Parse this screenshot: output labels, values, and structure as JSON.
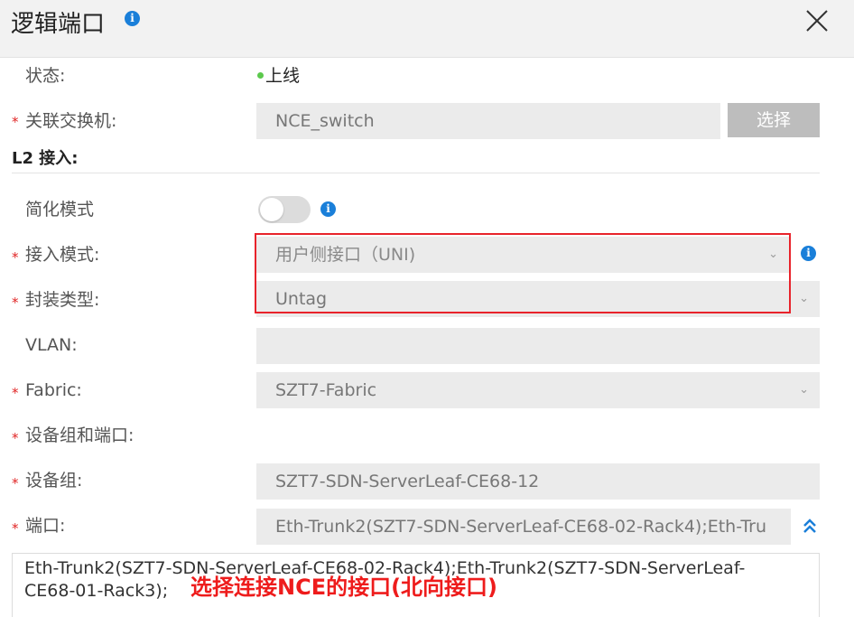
{
  "dialog": {
    "title": "逻辑端口",
    "close_symbol": "✕"
  },
  "form": {
    "status": {
      "label": "状态:",
      "value": "上线",
      "dot_color": "#5cc94d"
    },
    "switch": {
      "required": "*",
      "label": "关联交换机:",
      "value": "NCE_switch",
      "button": "选择"
    },
    "section_title": "L2 接入:",
    "simplified_mode": {
      "label": "简化模式",
      "enabled": false
    },
    "access_mode": {
      "required": "*",
      "label": "接入模式:",
      "value": "用户侧接口（UNI)"
    },
    "encapsulation": {
      "required": "*",
      "label": "封装类型:",
      "value": "Untag"
    },
    "vlan": {
      "label": "VLAN:",
      "value": ""
    },
    "fabric": {
      "required": "*",
      "label": "Fabric:",
      "value": "SZT7-Fabric"
    },
    "device_group_port": {
      "required": "*",
      "label": "设备组和端口:"
    },
    "device_group": {
      "required": "*",
      "label": "设备组:",
      "value": "SZT7-SDN-ServerLeaf-CE68-12"
    },
    "port": {
      "required": "*",
      "label": "端口:",
      "value": "Eth-Trunk2(SZT7-SDN-ServerLeaf-CE68-02-Rack4);Eth-Tru",
      "full_text": "Eth-Trunk2(SZT7-SDN-ServerLeaf-CE68-02-Rack4);Eth-Trunk2(SZT7-SDN-ServerLeaf-CE68-01-Rack3);",
      "annotation": "选择连接NCE的接口(北向接口)"
    }
  },
  "icons": {
    "info": "info-icon",
    "close": "close-icon",
    "chevron": "chevron-down-icon",
    "expand": "double-chevron-up-icon"
  },
  "colors": {
    "accent": "#1a7fd9",
    "required": "#e02424",
    "highlight": "#e8232b",
    "annotation": "#ee1c1c"
  }
}
